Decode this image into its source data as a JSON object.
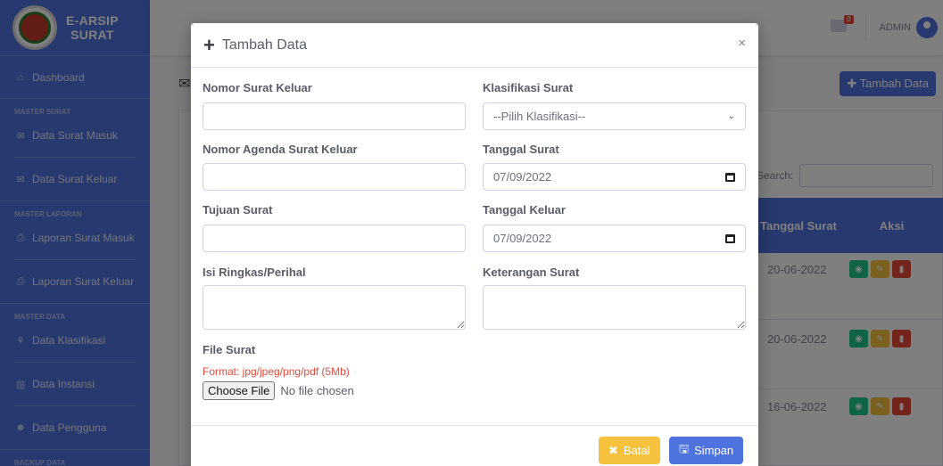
{
  "brand": {
    "line1": "E-ARSIP",
    "line2": "SURAT"
  },
  "sidebar": {
    "dashboard": "Dashboard",
    "section_master_surat": "MASTER SURAT",
    "surat_masuk": "Data Surat Masuk",
    "surat_keluar": "Data Surat Keluar",
    "section_master_laporan": "MASTER LAPORAN",
    "laporan_masuk": "Laporan Surat Masuk",
    "laporan_keluar": "Laporan Surat Keluar",
    "section_master_data": "MASTER DATA",
    "klasifikasi": "Data Klasifikasi",
    "instansi": "Data Instansi",
    "pengguna": "Data Pengguna",
    "section_backup": "BACKUP DATA"
  },
  "topbar": {
    "badge": "0",
    "user": "ADMIN"
  },
  "page": {
    "add_button": "Tambah Data",
    "search_label": "Search:",
    "col_tanggal": "Tanggal Surat",
    "col_aksi": "Aksi",
    "rows": [
      {
        "date": "20-06-2022"
      },
      {
        "date": "20-06-2022"
      },
      {
        "date": "16-06-2022"
      }
    ]
  },
  "modal": {
    "title": "Tambah Data",
    "close": "×",
    "nomor_surat_label": "Nomor Surat Keluar",
    "nomor_surat_value": "",
    "klasifikasi_label": "Klasifikasi Surat",
    "klasifikasi_value": "--Pilih Klasifikasi--",
    "agenda_label": "Nomor Agenda Surat Keluar",
    "agenda_value": "",
    "tanggal_surat_label": "Tanggal Surat",
    "tanggal_surat_value": "07/09/2022",
    "tujuan_label": "Tujuan Surat",
    "tujuan_value": "",
    "tanggal_keluar_label": "Tanggal Keluar",
    "tanggal_keluar_value": "07/09/2022",
    "isi_label": "Isi Ringkas/Perihal",
    "keterangan_label": "Keterangan Surat",
    "file_label": "File Surat",
    "file_hint": "Format: jpg/jpeg/png/pdf (5Mb)",
    "file_button": "Choose File",
    "file_status": "No file chosen",
    "batal": "Batal",
    "simpan": "Simpan"
  },
  "colors": {
    "primary": "#4e73df",
    "warning": "#f6c23e",
    "danger": "#e74a3b",
    "success": "#1cc88a"
  }
}
